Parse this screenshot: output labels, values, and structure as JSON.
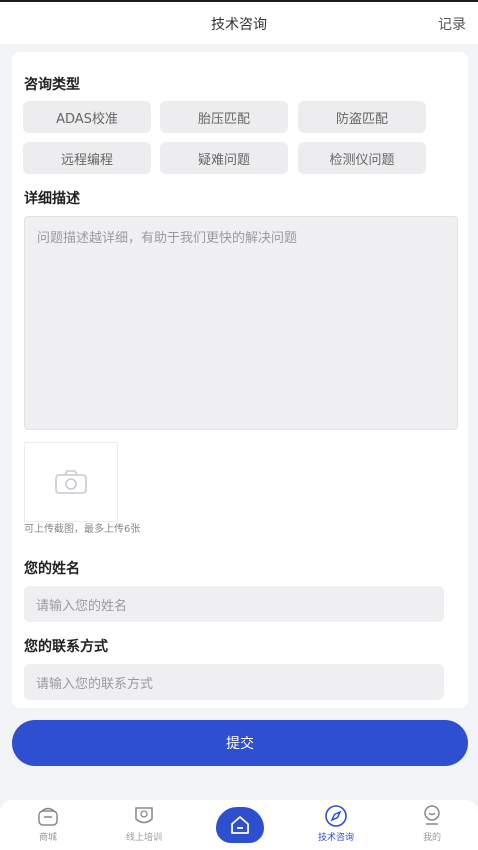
{
  "header": {
    "title": "技术咨询",
    "record_label": "记录"
  },
  "consult_type": {
    "title": "咨询类型",
    "chips": [
      "ADAS校准",
      "胎压匹配",
      "防盗匹配",
      "远程编程",
      "疑难问题",
      "检测仪问题"
    ]
  },
  "description": {
    "title": "详细描述",
    "placeholder": "问题描述越详细，有助于我们更快的解决问题"
  },
  "upload": {
    "hint": "可上传截图，最多上传6张"
  },
  "name": {
    "title": "您的姓名",
    "placeholder": "请输入您的姓名"
  },
  "contact": {
    "title": "您的联系方式",
    "placeholder": "请输入您的联系方式"
  },
  "submit_label": "提交",
  "tabbar": {
    "tabs": [
      {
        "label": "商城",
        "icon": "shop-icon"
      },
      {
        "label": "线上培训",
        "icon": "training-icon"
      },
      {
        "label": "",
        "icon": "home-icon"
      },
      {
        "label": "技术咨询",
        "icon": "compass-icon"
      },
      {
        "label": "我的",
        "icon": "profile-icon"
      }
    ]
  },
  "colors": {
    "accent": "#2d4fd0",
    "chip_bg": "#ededef",
    "page_bg": "#f2f3f7"
  }
}
